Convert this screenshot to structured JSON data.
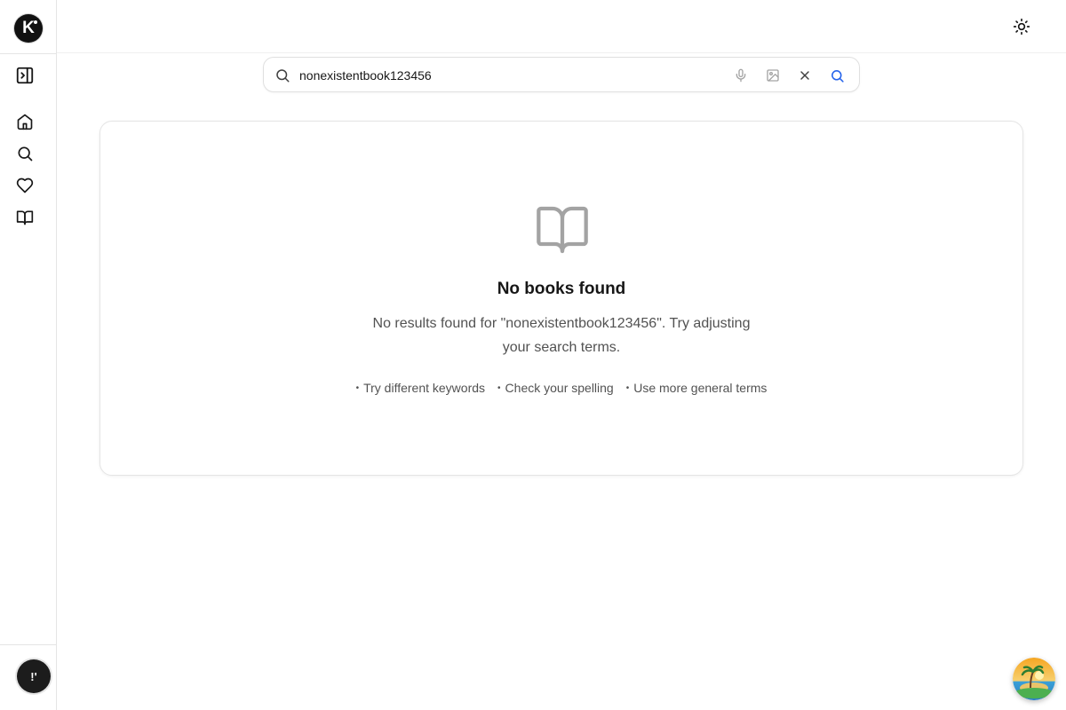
{
  "app": {
    "logo_letter": "K"
  },
  "sidebar": {
    "items": [
      {
        "name": "toggle-sidebar",
        "icon": "panel-toggle-icon"
      },
      {
        "name": "home",
        "icon": "home-icon"
      },
      {
        "name": "search",
        "icon": "search-icon"
      },
      {
        "name": "favorites",
        "icon": "heart-icon"
      },
      {
        "name": "library",
        "icon": "book-open-icon"
      }
    ],
    "avatar_initial": "!'"
  },
  "search": {
    "value": "nonexistentbook123456",
    "placeholder": "Search books..."
  },
  "results": {
    "empty_title": "No books found",
    "empty_message": "No results found for \"nonexistentbook123456\". Try adjusting your search terms.",
    "tips": [
      "Try different keywords",
      "Check your spelling",
      "Use more general terms"
    ]
  },
  "colors": {
    "accent": "#2563eb",
    "muted_icon": "#a3a3a3",
    "border": "#e5e5e5"
  }
}
